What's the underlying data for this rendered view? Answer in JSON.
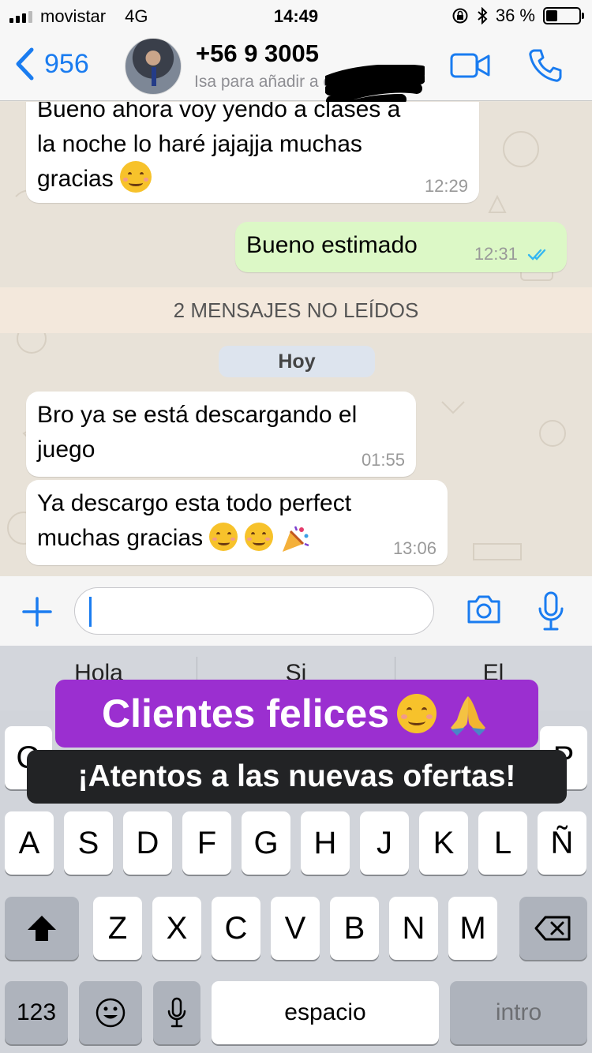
{
  "status_bar": {
    "carrier": "movistar",
    "network": "4G",
    "time": "14:49",
    "battery_text": "36 %",
    "battery_level": 0.36,
    "icons": [
      "signal-icon",
      "rotation-lock-icon",
      "bluetooth-icon",
      "battery-icon"
    ]
  },
  "nav": {
    "back_count": "956",
    "contact_name": "+56 9 3005",
    "contact_subtitle": "Isa para añadir a contactos",
    "icons": [
      "back-chevron-icon",
      "avatar",
      "video-call-icon",
      "phone-icon"
    ]
  },
  "messages": [
    {
      "text_line1": "Bueno ahora voy yendo a clases a",
      "text_line2": "la noche lo haré jajajja muchas",
      "text_line3": "gracias",
      "time": "12:29",
      "direction": "in"
    },
    {
      "text": "Bueno estimado",
      "time": "12:31",
      "direction": "out",
      "status": "read"
    },
    {
      "text_line1": "Bro ya se está descargando el",
      "text_line2": "juego",
      "time": "01:55",
      "direction": "in"
    },
    {
      "text_line1": "Ya descargo esta todo perfect",
      "text_line2": "muchas gracias",
      "time": "13:06",
      "direction": "in"
    }
  ],
  "unread_banner": "2 MENSAJES NO LEÍDOS",
  "date_chip": "Hoy",
  "input": {
    "value": "",
    "placeholder": ""
  },
  "keyboard": {
    "suggestions": [
      "Hola",
      "Si",
      "El"
    ],
    "row2": [
      "A",
      "S",
      "D",
      "F",
      "G",
      "H",
      "J",
      "K",
      "L",
      "Ñ"
    ],
    "row3": [
      "Z",
      "X",
      "C",
      "V",
      "B",
      "N",
      "M"
    ],
    "numbers_key": "123",
    "space_key": "espacio",
    "return_key": "intro",
    "row1_partial_left": "Q",
    "row1_partial_right": "P"
  },
  "overlay": {
    "title": "Clientes felices",
    "subtitle": "¡Atentos a las nuevas ofertas!",
    "banner_color": "#9b2fd0"
  },
  "colors": {
    "accent": "#1a7cf0",
    "outgoing_bubble": "#dcf8c6",
    "read_ticks": "#34b7f1"
  }
}
